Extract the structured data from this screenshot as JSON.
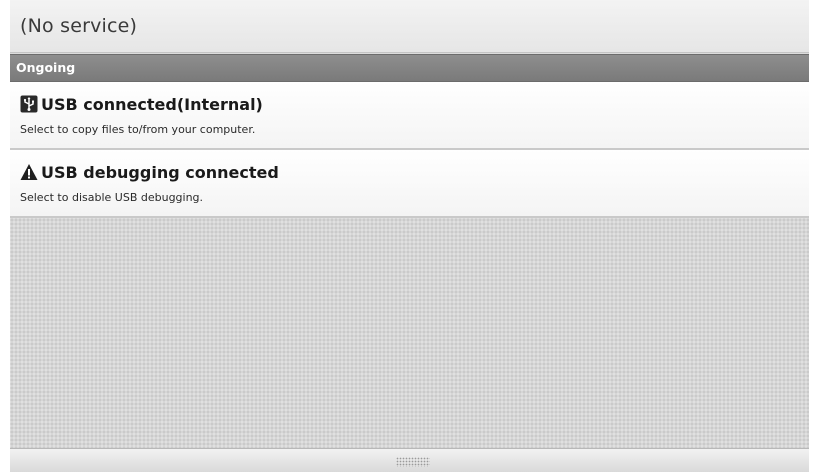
{
  "status_bar": {
    "carrier": "(No service)"
  },
  "section": {
    "title": "Ongoing"
  },
  "notifications": [
    {
      "icon": "usb-icon",
      "title": "USB connected(Internal)",
      "description": "Select to copy files to/from your computer."
    },
    {
      "icon": "warning-icon",
      "title": "USB debugging connected",
      "description": "Select to disable USB debugging."
    }
  ],
  "colors": {
    "header_bg": "#7f7f7f",
    "shade_bg": "#d6d6d6",
    "item_bg": "#ffffff"
  }
}
